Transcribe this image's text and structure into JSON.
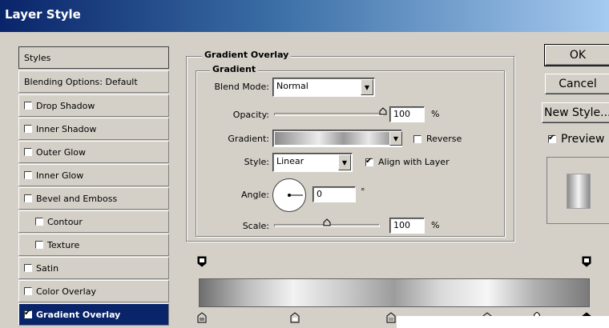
{
  "window": {
    "title": "Layer Style"
  },
  "styles_list": {
    "header": "Styles",
    "items": [
      {
        "label": "Blending Options: Default",
        "checkbox": false,
        "checked": false,
        "sub": false,
        "selected": false
      },
      {
        "label": "Drop Shadow",
        "checkbox": true,
        "checked": false,
        "sub": false,
        "selected": false
      },
      {
        "label": "Inner Shadow",
        "checkbox": true,
        "checked": false,
        "sub": false,
        "selected": false
      },
      {
        "label": "Outer Glow",
        "checkbox": true,
        "checked": false,
        "sub": false,
        "selected": false
      },
      {
        "label": "Inner Glow",
        "checkbox": true,
        "checked": false,
        "sub": false,
        "selected": false
      },
      {
        "label": "Bevel and Emboss",
        "checkbox": true,
        "checked": false,
        "sub": false,
        "selected": false
      },
      {
        "label": "Contour",
        "checkbox": true,
        "checked": false,
        "sub": true,
        "selected": false
      },
      {
        "label": "Texture",
        "checkbox": true,
        "checked": false,
        "sub": true,
        "selected": false
      },
      {
        "label": "Satin",
        "checkbox": true,
        "checked": false,
        "sub": false,
        "selected": false
      },
      {
        "label": "Color Overlay",
        "checkbox": true,
        "checked": false,
        "sub": false,
        "selected": false
      },
      {
        "label": "Gradient Overlay",
        "checkbox": true,
        "checked": true,
        "sub": false,
        "selected": true
      }
    ]
  },
  "gradient_overlay": {
    "group_title": "Gradient Overlay",
    "subgroup_title": "Gradient",
    "blend_mode_label": "Blend Mode:",
    "blend_mode_value": "Normal",
    "opacity_label": "Opacity:",
    "opacity_value": "100",
    "opacity_unit": "%",
    "opacity_level": 1.0,
    "gradient_label": "Gradient:",
    "reverse_label": "Reverse",
    "reverse_checked": false,
    "style_label": "Style:",
    "style_value": "Linear",
    "align_label": "Align with Layer",
    "align_checked": true,
    "angle_label": "Angle:",
    "angle_value": "0",
    "angle_unit": "°",
    "scale_label": "Scale:",
    "scale_value": "100",
    "scale_unit": "%",
    "scale_level": 0.5
  },
  "buttons": {
    "ok": "OK",
    "cancel": "Cancel",
    "new_style": "New Style...",
    "preview_label": "Preview",
    "preview_checked": true
  },
  "colors": {
    "title_bar_start": "#0a246a",
    "dialog_bg": "#d4d0c8",
    "selection": "#0a246a"
  },
  "gradient_editor": {
    "opacity_stops": 2,
    "color_stops": 6
  }
}
